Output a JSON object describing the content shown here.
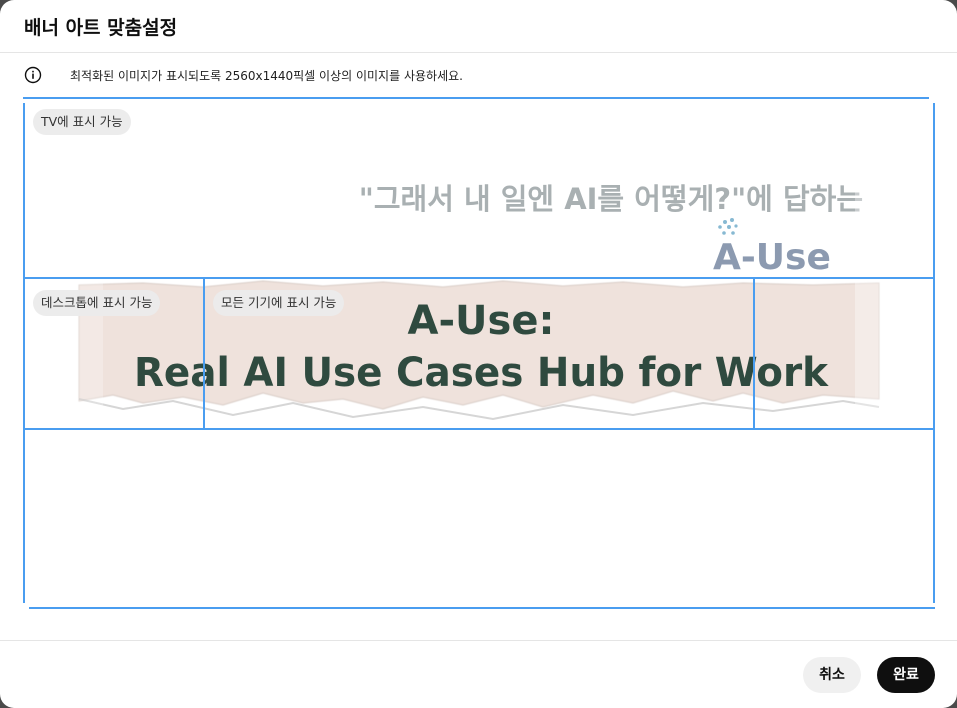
{
  "dialog": {
    "title": "배너 아트 맞춤설정"
  },
  "info": {
    "icon": "info-icon",
    "text": "최적화된 이미지가 표시되도록 2560x1440픽셀 이상의 이미지를 사용하세요."
  },
  "preview": {
    "zones": {
      "tv_label": "TV에 표시 가능",
      "desktop_label": "데스크톱에 표시 가능",
      "all_devices_label": "모든 기기에 표시 가능"
    },
    "banner": {
      "tagline": "\"그래서 내 일엔 AI를 어떻게?\"에 답하는",
      "logo_text": "A-Use",
      "headline_1": "A-Use:",
      "headline_2": "Real AI Use Cases Hub for Work"
    },
    "colors": {
      "zone_outline": "#4a9df0",
      "headline": "#2f4a3f",
      "tagline": "#a9b0b2",
      "paper_strip": "#efe2dc"
    }
  },
  "footer": {
    "cancel_label": "취소",
    "done_label": "완료"
  }
}
